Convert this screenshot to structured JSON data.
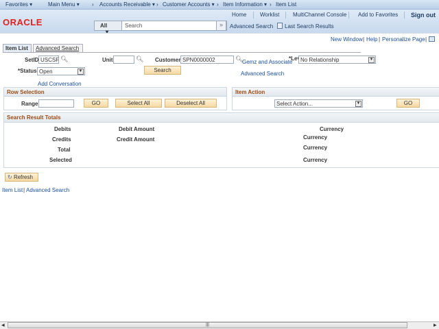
{
  "nav": {
    "favorites": "Favorites ▾",
    "main_menu": "Main Menu ▾",
    "breadcrumbs": [
      "Accounts Receivable ▾",
      "Customer Accounts ▾",
      "Item Information ▾",
      "Item List"
    ]
  },
  "header": {
    "logo": "ORACLE",
    "links": [
      "Home",
      "Worklist",
      "MultiChannel Console",
      "Add to Favorites"
    ],
    "signout": "Sign out",
    "search_scope": "All",
    "search_placeholder": "Search",
    "advanced_search": "Advanced Search",
    "last_results": "Last Search Results"
  },
  "pagebar": {
    "new_window": "New Window",
    "help": "Help",
    "personalize": "Personalize Page"
  },
  "tabs": [
    "Item List",
    "Advanced Search"
  ],
  "form": {
    "setid_label": "SetID",
    "setid": "USCSP",
    "unit_label": "Unit",
    "unit": "",
    "customer_label": "Customer",
    "customer": "SPN0000002",
    "customer_name": "Gemz and Associate",
    "level_label": "*Lev",
    "level": "No Relationship",
    "status_label": "*Status",
    "status": "Open",
    "search_btn": "Search",
    "advanced_search": "Advanced Search",
    "add_conversation": "Add Conversation"
  },
  "row_selection": {
    "title": "Row Selection",
    "range_label": "Range",
    "range": "",
    "go": "GO",
    "select_all": "Select All",
    "deselect_all": "Deselect All"
  },
  "item_action": {
    "title": "Item Action",
    "select": "Select Action...",
    "go": "GO"
  },
  "totals": {
    "title": "Search Result Totals",
    "debits": "Debits",
    "debit_amount": "Debit Amount",
    "credits": "Credits",
    "credit_amount": "Credit Amount",
    "total": "Total",
    "selected": "Selected",
    "currency": "Currency"
  },
  "refresh": "Refresh",
  "footer": {
    "item_list": "Item List",
    "advanced_search": "Advanced Search"
  }
}
